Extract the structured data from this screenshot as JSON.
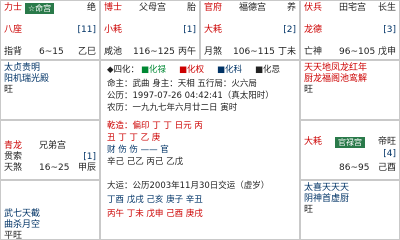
{
  "top": {
    "c0": {
      "l1": "力士",
      "tag": "☆命宫",
      "r1": "绝",
      "l2": "八座",
      "r2": "[11]",
      "l3": "指背",
      "m3": "6~15",
      "r3": "乙巳"
    },
    "c1": {
      "l1": "博士",
      "m1": "父母宫",
      "r1": "胎",
      "l2": "小耗",
      "r2": "[1]",
      "l3": "咸池",
      "m3": "116~125",
      "r3": "丙午"
    },
    "c2": {
      "l1": "官府",
      "m1": "福德宫",
      "r1": "养",
      "l2": "大耗",
      "r2": "[2]",
      "l3": "月煞",
      "m3": "106~115",
      "r3": "丁未"
    },
    "c3": {
      "l1": "伏兵",
      "m1": "田宅宫",
      "r1": "长生",
      "l2": "龙德",
      "r2": "[3]",
      "l3": "亡神",
      "m3": "96~105",
      "r3": "戊申"
    }
  },
  "left": {
    "c0": {
      "a": "太贞贵明",
      "b": "阳机瑞光殿",
      "c": "旺"
    },
    "c1": {
      "l1": "青龙",
      "m1": "兄弟宫",
      "r1": "",
      "l2": "贯索",
      "r2": "[1]",
      "l3": "天煞",
      "m3": "16~25",
      "r3": "甲辰"
    },
    "c2": {
      "a": "武七天截",
      "b": "曲杀月空",
      "c": "平旺"
    }
  },
  "right": {
    "c0": {
      "a": "天天地凤龙红年",
      "b": "厨龙福阁池鸾解",
      "c": "旺"
    },
    "c1": {
      "l1": "大耗",
      "tag": "官禄宫",
      "r1": "帝旺",
      "l2": "",
      "r2": "[4]",
      "l3": "",
      "m3": "86~95",
      "r3": "己酉"
    },
    "c2": {
      "a": "太喜天天天",
      "b": "阴神首虚厨",
      "c": "旺"
    }
  },
  "center": {
    "title": "◆四化：",
    "h1": "■化禄",
    "h2": "■化权",
    "h3": "■化科",
    "h4": "■化忌",
    "line1": "命主：武曲 身主：天相 五行局：火六局",
    "line2": "公历：1997-07-26 04:42:41（真太阳时）",
    "line3": "农历：一九九七年六月廿二日 寅时",
    "line4": "乾造：偏印  丁  丁  日元  丙",
    "line5": "      丑    丁  丁  乙   庚",
    "line6": "      财    伤  伤  ——  官",
    "line7": "      辛己  己乙  丙己  乙戊",
    "line8": "大运：公历2003年11月30日交运（虚岁）",
    "line9": "       丁酉  戊戌  己亥  庚子  辛丑",
    "line10": "      丙午 丁未 戊申 己酉 庚戌"
  }
}
